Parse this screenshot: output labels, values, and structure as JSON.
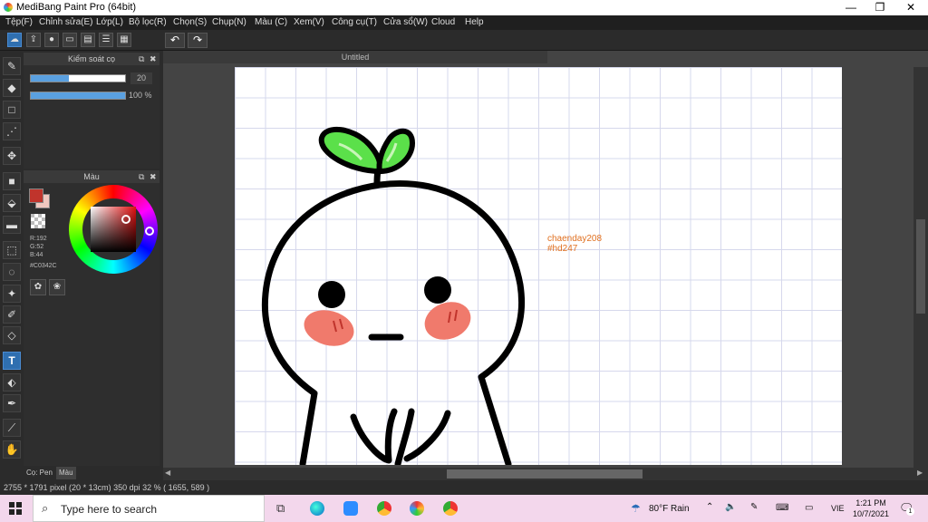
{
  "window": {
    "title": "MediBang Paint Pro (64bit)",
    "minimize": "—",
    "maximize": "❐",
    "close": "✕"
  },
  "menu": [
    "Tệp(F)",
    "Chỉnh sửa(E)",
    "Lớp(L)",
    "Bộ lọc(R)",
    "Chọn(S)",
    "Chụp(N)",
    "Màu (C)",
    "Xem(V)",
    "Công cụ(T)",
    "Cửa sổ(W)",
    "Cloud",
    "Help"
  ],
  "toolbar": {
    "icons": [
      "cloud-icon",
      "share-icon",
      "comment-icon",
      "chat-icon",
      "page-icon",
      "list-icon",
      "grid-icon"
    ],
    "undo": "↶",
    "redo": "↷"
  },
  "tools": [
    "brush-icon",
    "eraser-icon",
    "rectangle-icon",
    "dotted-brush-icon",
    "move-icon",
    "fill-square-icon",
    "bucket-icon",
    "gradient-icon",
    "select-rect-icon",
    "lasso-icon",
    "magic-wand-icon",
    "select-pen-icon",
    "select-eraser-icon",
    "text-icon",
    "divide-icon",
    "dropper-icon",
    "pipette-icon",
    "hand-icon"
  ],
  "brush_panel": {
    "title": "Kiểm soát cọ",
    "size_value": "20",
    "size_level": 0.4,
    "opacity_value": "100 %",
    "opacity_level": 1.0
  },
  "color_panel": {
    "title": "Màu",
    "r": "R:192",
    "g": "G:52",
    "b": "B:44",
    "hex": "#C0342C",
    "foreground": "#C0342C",
    "background": "#f0c8c0"
  },
  "bottom_tabs": {
    "pen": "Cọ: Pen",
    "color": "Màu"
  },
  "document": {
    "tab_title": "Untitled",
    "watermark_line1": "chaenday208",
    "watermark_line2": "#hd247"
  },
  "status": {
    "text": "2755 * 1791 pixel   (20 * 13cm)   350 dpi   32 %   ( 1655, 589 )"
  },
  "taskbar": {
    "search_placeholder": "Type here to search",
    "weather": "80°F  Rain",
    "language": "VIE",
    "time": "1:21 PM",
    "date": "10/7/2021",
    "notification_count": "1"
  }
}
